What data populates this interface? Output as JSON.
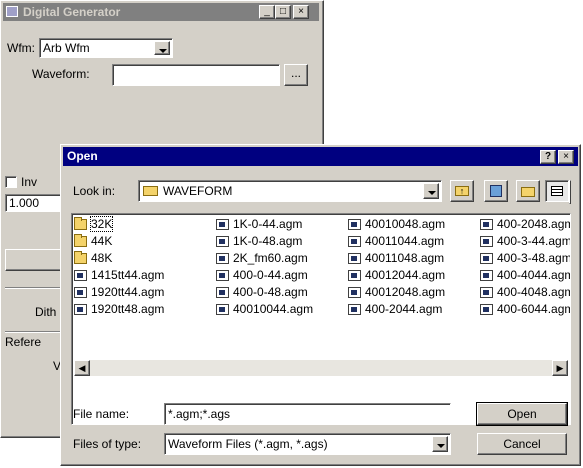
{
  "parent_window": {
    "title": "Digital Generator",
    "wfm_label": "Wfm:",
    "wfm_value": "Arb Wfm",
    "waveform_label": "Waveform:",
    "waveform_value": "",
    "browse_label": "...",
    "inv_label": "Inv",
    "value_1000": "1.000",
    "dith_label": "Dith",
    "refere_label": "Refere",
    "v_label": "V"
  },
  "dialog": {
    "title": "Open",
    "help_label": "?",
    "close_label": "×",
    "look_in_label": "Look in:",
    "look_in_value": "WAVEFORM",
    "file_name_label": "File name:",
    "file_name_value": "*.agm;*.ags",
    "files_of_type_label": "Files of type:",
    "files_of_type_value": "Waveform Files (*.agm, *.ags)",
    "open_button": "Open",
    "cancel_button": "Cancel",
    "columns": [
      [
        "32K",
        "44K",
        "48K",
        "1415tt44.agm",
        "1920tt44.agm",
        "1920tt48.agm"
      ],
      [
        "1K-0-44.agm",
        "1K-0-48.agm",
        "2K_fm60.agm",
        "400-0-44.agm",
        "400-0-48.agm",
        "40010044.agm"
      ],
      [
        "40010048.agm",
        "40011044.agm",
        "40011048.agm",
        "40012044.agm",
        "40012048.agm",
        "400-2044.agm"
      ],
      [
        "400-2048.agm",
        "400-3-44.agm",
        "400-3-48.agm",
        "400-4044.agm",
        "400-4048.agm",
        "400-6044.agm"
      ]
    ],
    "folder_count": 3
  },
  "colors": {
    "title_active": "#000080",
    "title_inactive": "#808080",
    "face": "#d4d0c8"
  }
}
